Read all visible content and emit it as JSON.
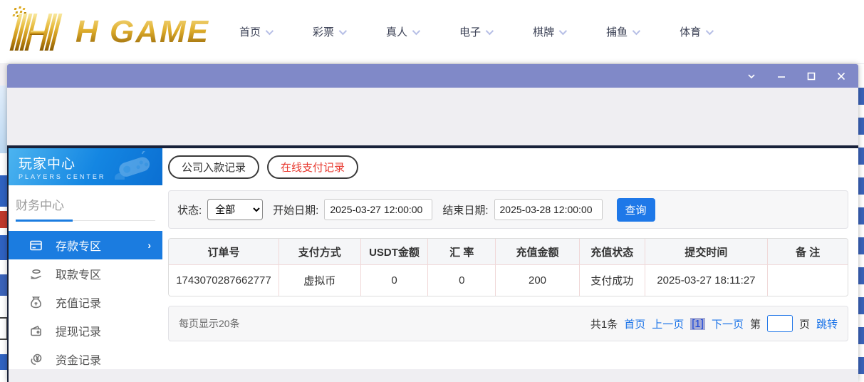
{
  "brand": {
    "logo_text": "H GAME"
  },
  "nav": {
    "items": [
      {
        "label": "首页"
      },
      {
        "label": "彩票"
      },
      {
        "label": "真人"
      },
      {
        "label": "电子"
      },
      {
        "label": "棋牌"
      },
      {
        "label": "捕鱼"
      },
      {
        "label": "体育"
      }
    ]
  },
  "window": {
    "controls": [
      "collapse",
      "minimize",
      "maximize",
      "close"
    ]
  },
  "sidebar": {
    "title": "玩家中心",
    "subtitle": "PLAYERS CENTER",
    "section": "财务中心",
    "items": [
      {
        "label": "存款专区",
        "icon": "deposit-card-icon",
        "active": true
      },
      {
        "label": "取款专区",
        "icon": "hand-coin-icon",
        "active": false
      },
      {
        "label": "充值记录",
        "icon": "money-bag-icon",
        "active": false
      },
      {
        "label": "提现记录",
        "icon": "wallet-icon",
        "active": false
      },
      {
        "label": "资金记录",
        "icon": "coins-icon",
        "active": false
      }
    ],
    "active_arrow": "›"
  },
  "tabs": [
    {
      "label": "公司入款记录",
      "active": false
    },
    {
      "label": "在线支付记录",
      "active": true
    }
  ],
  "filters": {
    "status_label": "状态:",
    "status_value": "全部",
    "start_label": "开始日期:",
    "start_value": "2025-03-27 12:00:00",
    "end_label": "结束日期:",
    "end_value": "2025-03-28 12:00:00",
    "search_label": "查询"
  },
  "table": {
    "headers": [
      "订单号",
      "支付方式",
      "USDT金额",
      "汇 率",
      "充值金额",
      "充值状态",
      "提交时间",
      "备 注"
    ],
    "rows": [
      [
        "1743070287662777",
        "虚拟币",
        "0",
        "0",
        "200",
        "支付成功",
        "2025-03-27 18:11:27",
        ""
      ]
    ]
  },
  "pagination": {
    "page_size_text": "每页显示20条",
    "total_text": "共1条",
    "first": "首页",
    "prev": "上一页",
    "current": "[1]",
    "next": "下一页",
    "jump_prefix": "第",
    "jump_suffix": "页",
    "jump_action": "跳转"
  },
  "colors": {
    "titlebar": "#8089c8",
    "sidebar_active": "#1b7ce0",
    "accent_blue": "#1e78e8",
    "link_blue": "#1a73e8",
    "tab_red": "#e8382e",
    "divider_dark": "#18213a",
    "table_border_pink": "#f0d8d8"
  }
}
